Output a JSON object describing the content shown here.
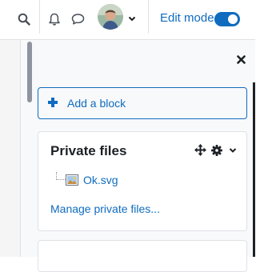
{
  "navbar": {
    "search_icon": "search-icon",
    "notifications_icon": "bell-icon",
    "messages_icon": "speech-bubble-icon",
    "user_menu_icon": "chevron-down-icon",
    "edit_mode_label": "Edit mode",
    "edit_mode_on": true
  },
  "drawer": {
    "close_icon": "close-icon",
    "add_block_label": "Add a block",
    "add_block_icon": "plus-icon"
  },
  "private_files_block": {
    "title": "Private files",
    "controls": [
      "move-icon",
      "gear-icon",
      "chevron-down-icon"
    ],
    "files": [
      {
        "name": "Ok.svg",
        "icon": "image-file-icon"
      }
    ],
    "manage_link": "Manage private files..."
  },
  "colors": {
    "accent": "#0f6cbf",
    "text": "#1d2125",
    "border": "#dee2e6",
    "drawer_bg": "#f8f9fa"
  }
}
